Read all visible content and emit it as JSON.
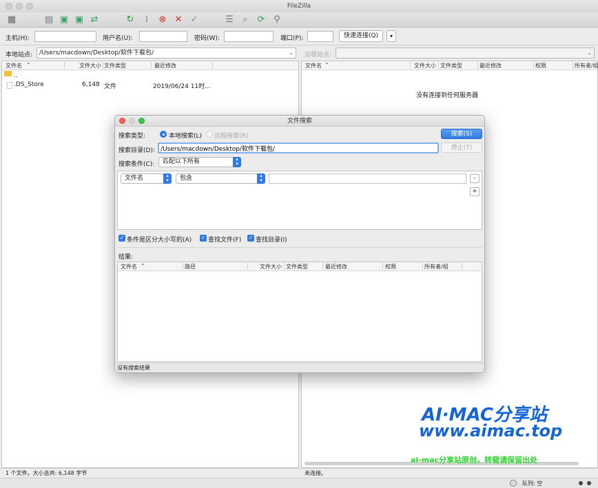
{
  "window": {
    "title": "FileZilla"
  },
  "quickconnect": {
    "host_label": "主机(H):",
    "user_label": "用户名(U):",
    "pass_label": "密码(W):",
    "port_label": "端口(P):",
    "connect_label": "快速连接(Q)",
    "dropdown_glyph": "▾",
    "host_value": "",
    "user_value": "",
    "pass_value": "",
    "port_value": ""
  },
  "local": {
    "site_label": "本地站点:",
    "path": "/Users/macdown/Desktop/软件下载包/",
    "columns": [
      "文件名",
      "文件大小",
      "文件类型",
      "最近修改"
    ],
    "files": [
      {
        "name": "..",
        "size": "",
        "type": "",
        "modified": ""
      },
      {
        "name": ".DS_Store",
        "size": "6,148",
        "type": "文件",
        "modified": "2019/06/24 11时..."
      }
    ],
    "status": "1 个文件。大小总共: 6,148 字节"
  },
  "remote": {
    "site_label": "远程站点:",
    "path": "",
    "columns": [
      "文件名",
      "文件大小",
      "文件类型",
      "最近修改",
      "权限",
      "所有者/组"
    ],
    "empty_message": "没有连接到任何服务器",
    "status": "未连接。"
  },
  "queue": {
    "label": "队列: 空"
  },
  "search_dialog": {
    "title": "文件搜索",
    "search_type_label": "搜索类型:",
    "local_search": "本地搜索(L)",
    "remote_search": "远程搜索(R)",
    "search_button": "搜索(S)",
    "stop_button": "停止(T)",
    "dir_label": "搜索目录(D):",
    "dir_value": "/Users/macdown/Desktop/软件下载包/",
    "condition_label": "搜索条件(C):",
    "condition_value": "匹配以下所有",
    "filter_field": "文件名",
    "filter_op": "包含",
    "filter_value": "",
    "remove_glyph": "-",
    "add_glyph": "+",
    "checkbox_case": "条件是区分大小写的(A)",
    "checkbox_files": "查找文件(F)",
    "checkbox_dirs": "查找目录(I)",
    "results_label": "结果:",
    "result_columns": [
      "文件名",
      "路径",
      "文件大小",
      "文件类型",
      "最近修改",
      "权限",
      "所有者/组"
    ],
    "status": "没有搜索结果"
  },
  "watermark": {
    "line1": "AI·MAC分享站",
    "line2": "www.aimac.top",
    "line3": "ai-mac分享站原创，转载请保留出处"
  },
  "colors": {
    "accent": "#2f7ae5",
    "watermark_blue": "#1565d8",
    "watermark_green": "#2cd42c"
  }
}
